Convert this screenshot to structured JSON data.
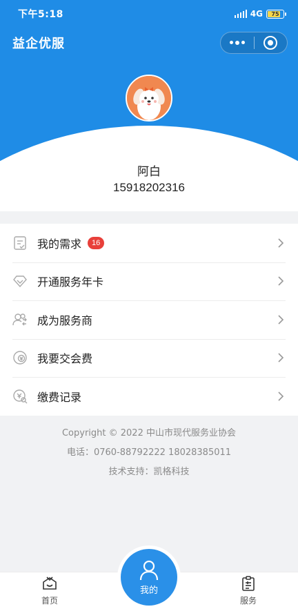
{
  "status_bar": {
    "time": "下午5:18",
    "network": "4G",
    "battery": "75",
    "battery_level": 0.75
  },
  "header": {
    "title": "益企优服",
    "more_icon": "more-dots-icon",
    "close_icon": "target-circle-icon"
  },
  "profile": {
    "name": "阿白",
    "phone": "15918202316",
    "avatar_icon": "puppy-avatar"
  },
  "menu": {
    "items": [
      {
        "label": "我的需求",
        "badge": "16",
        "icon": "document-check-icon"
      },
      {
        "label": "开通服务年卡",
        "icon": "diamond-icon"
      },
      {
        "label": "成为服务商",
        "icon": "users-exchange-icon"
      },
      {
        "label": "我要交会费",
        "icon": "coin-icon"
      },
      {
        "label": "缴费记录",
        "icon": "yen-search-icon"
      }
    ]
  },
  "footer": {
    "copyright": "Copyright © 2022 中山市现代服务业协会",
    "phone": "电话：0760-88792222 18028385011",
    "support": "技术支持：凯格科技"
  },
  "tabs": [
    {
      "label": "首页",
      "icon": "home-gift-icon"
    },
    {
      "label": "我的",
      "icon": "user-icon"
    },
    {
      "label": "服务",
      "icon": "clipboard-list-icon"
    }
  ],
  "colors": {
    "primary": "#1f8ce6",
    "badge": "#e8403a",
    "background": "#f1f2f4"
  }
}
